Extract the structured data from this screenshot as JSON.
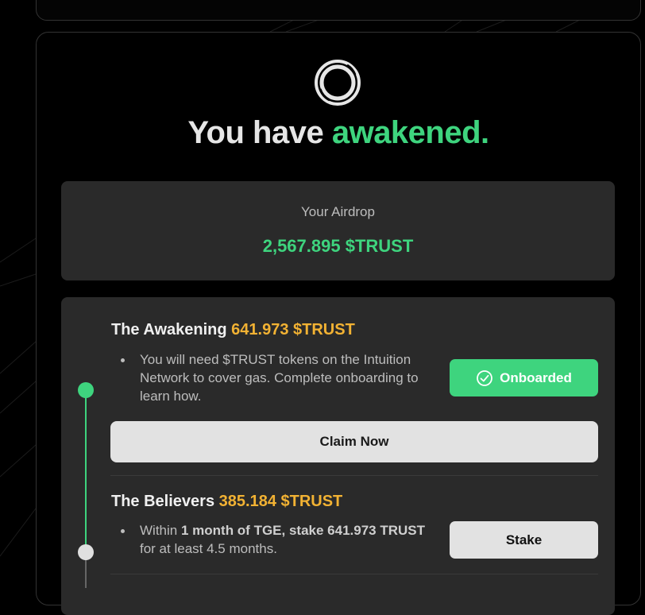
{
  "headline": {
    "prefix": "You have ",
    "accent": "awakened."
  },
  "airdrop": {
    "label": "Your Airdrop",
    "amount": "2,567.895 $TRUST"
  },
  "phases": [
    {
      "title": "The Awakening",
      "amount": "641.973 $TRUST",
      "bullet": "You will need $TRUST tokens on the Intuition Network to cover gas. Complete onboarding to learn how.",
      "status_button": {
        "label": "Onboarded",
        "icon": "check-circle-icon"
      },
      "claim_button": "Claim Now",
      "state": "complete"
    },
    {
      "title": "The Believers",
      "amount": "385.184 $TRUST",
      "bullet_parts": {
        "pre": "Within ",
        "bold1": "1 month of TGE, stake 641.973 TRUST",
        "post": " for at least 4.5 months."
      },
      "action_button": "Stake",
      "state": "pending"
    }
  ],
  "colors": {
    "accent_green": "#3ed47e",
    "amount_yellow": "#f2b233",
    "panel": "#2a2a2a"
  }
}
